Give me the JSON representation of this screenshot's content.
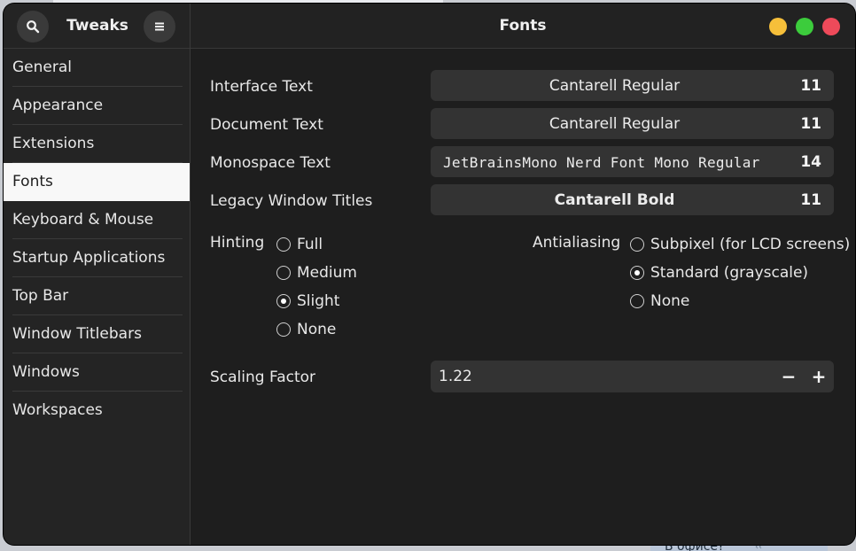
{
  "background": {
    "chat_snippet": "В офисе?",
    "chat_arrows": "‹‹"
  },
  "sidebar": {
    "title": "Tweaks",
    "search_icon": "search-icon",
    "menu_icon": "hamburger-menu-icon",
    "items": [
      {
        "label": "General"
      },
      {
        "label": "Appearance"
      },
      {
        "label": "Extensions"
      },
      {
        "label": "Fonts",
        "selected": true
      },
      {
        "label": "Keyboard & Mouse"
      },
      {
        "label": "Startup Applications"
      },
      {
        "label": "Top Bar"
      },
      {
        "label": "Window Titlebars"
      },
      {
        "label": "Windows"
      },
      {
        "label": "Workspaces"
      }
    ]
  },
  "header": {
    "title": "Fonts",
    "colors": {
      "minimize": "#f6bf3a",
      "maximize": "#3ccc3c",
      "close": "#ee4a5a"
    }
  },
  "fonts": {
    "interface": {
      "label": "Interface Text",
      "font": "Cantarell Regular",
      "size": "11"
    },
    "document": {
      "label": "Document Text",
      "font": "Cantarell Regular",
      "size": "11"
    },
    "monospace": {
      "label": "Monospace Text",
      "font": "JetBrainsMono Nerd Font Mono Regular",
      "size": "14"
    },
    "legacy": {
      "label": "Legacy Window Titles",
      "font": "Cantarell Bold",
      "size": "11"
    }
  },
  "hinting": {
    "label": "Hinting",
    "options": [
      "Full",
      "Medium",
      "Slight",
      "None"
    ],
    "selected": "Slight"
  },
  "antialiasing": {
    "label": "Antialiasing",
    "options": [
      "Subpixel (for LCD screens)",
      "Standard (grayscale)",
      "None"
    ],
    "selected": "Standard (grayscale)"
  },
  "scaling": {
    "label": "Scaling Factor",
    "value": "1.22",
    "minus": "−",
    "plus": "+"
  }
}
